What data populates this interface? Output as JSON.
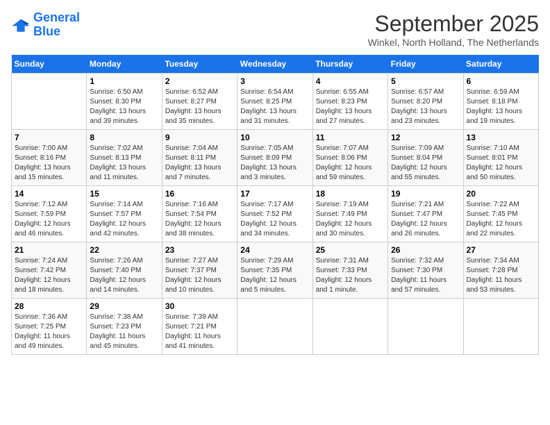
{
  "header": {
    "logo_line1": "General",
    "logo_line2": "Blue",
    "month": "September 2025",
    "location": "Winkel, North Holland, The Netherlands"
  },
  "days_of_week": [
    "Sunday",
    "Monday",
    "Tuesday",
    "Wednesday",
    "Thursday",
    "Friday",
    "Saturday"
  ],
  "weeks": [
    [
      {
        "day": "",
        "info": ""
      },
      {
        "day": "1",
        "info": "Sunrise: 6:50 AM\nSunset: 8:30 PM\nDaylight: 13 hours\nand 39 minutes."
      },
      {
        "day": "2",
        "info": "Sunrise: 6:52 AM\nSunset: 8:27 PM\nDaylight: 13 hours\nand 35 minutes."
      },
      {
        "day": "3",
        "info": "Sunrise: 6:54 AM\nSunset: 8:25 PM\nDaylight: 13 hours\nand 31 minutes."
      },
      {
        "day": "4",
        "info": "Sunrise: 6:55 AM\nSunset: 8:23 PM\nDaylight: 13 hours\nand 27 minutes."
      },
      {
        "day": "5",
        "info": "Sunrise: 6:57 AM\nSunset: 8:20 PM\nDaylight: 13 hours\nand 23 minutes."
      },
      {
        "day": "6",
        "info": "Sunrise: 6:59 AM\nSunset: 8:18 PM\nDaylight: 13 hours\nand 19 minutes."
      }
    ],
    [
      {
        "day": "7",
        "info": "Sunrise: 7:00 AM\nSunset: 8:16 PM\nDaylight: 13 hours\nand 15 minutes."
      },
      {
        "day": "8",
        "info": "Sunrise: 7:02 AM\nSunset: 8:13 PM\nDaylight: 13 hours\nand 11 minutes."
      },
      {
        "day": "9",
        "info": "Sunrise: 7:04 AM\nSunset: 8:11 PM\nDaylight: 13 hours\nand 7 minutes."
      },
      {
        "day": "10",
        "info": "Sunrise: 7:05 AM\nSunset: 8:09 PM\nDaylight: 13 hours\nand 3 minutes."
      },
      {
        "day": "11",
        "info": "Sunrise: 7:07 AM\nSunset: 8:06 PM\nDaylight: 12 hours\nand 59 minutes."
      },
      {
        "day": "12",
        "info": "Sunrise: 7:09 AM\nSunset: 8:04 PM\nDaylight: 12 hours\nand 55 minutes."
      },
      {
        "day": "13",
        "info": "Sunrise: 7:10 AM\nSunset: 8:01 PM\nDaylight: 12 hours\nand 50 minutes."
      }
    ],
    [
      {
        "day": "14",
        "info": "Sunrise: 7:12 AM\nSunset: 7:59 PM\nDaylight: 12 hours\nand 46 minutes."
      },
      {
        "day": "15",
        "info": "Sunrise: 7:14 AM\nSunset: 7:57 PM\nDaylight: 12 hours\nand 42 minutes."
      },
      {
        "day": "16",
        "info": "Sunrise: 7:16 AM\nSunset: 7:54 PM\nDaylight: 12 hours\nand 38 minutes."
      },
      {
        "day": "17",
        "info": "Sunrise: 7:17 AM\nSunset: 7:52 PM\nDaylight: 12 hours\nand 34 minutes."
      },
      {
        "day": "18",
        "info": "Sunrise: 7:19 AM\nSunset: 7:49 PM\nDaylight: 12 hours\nand 30 minutes."
      },
      {
        "day": "19",
        "info": "Sunrise: 7:21 AM\nSunset: 7:47 PM\nDaylight: 12 hours\nand 26 minutes."
      },
      {
        "day": "20",
        "info": "Sunrise: 7:22 AM\nSunset: 7:45 PM\nDaylight: 12 hours\nand 22 minutes."
      }
    ],
    [
      {
        "day": "21",
        "info": "Sunrise: 7:24 AM\nSunset: 7:42 PM\nDaylight: 12 hours\nand 18 minutes."
      },
      {
        "day": "22",
        "info": "Sunrise: 7:26 AM\nSunset: 7:40 PM\nDaylight: 12 hours\nand 14 minutes."
      },
      {
        "day": "23",
        "info": "Sunrise: 7:27 AM\nSunset: 7:37 PM\nDaylight: 12 hours\nand 10 minutes."
      },
      {
        "day": "24",
        "info": "Sunrise: 7:29 AM\nSunset: 7:35 PM\nDaylight: 12 hours\nand 5 minutes."
      },
      {
        "day": "25",
        "info": "Sunrise: 7:31 AM\nSunset: 7:33 PM\nDaylight: 12 hours\nand 1 minute."
      },
      {
        "day": "26",
        "info": "Sunrise: 7:32 AM\nSunset: 7:30 PM\nDaylight: 11 hours\nand 57 minutes."
      },
      {
        "day": "27",
        "info": "Sunrise: 7:34 AM\nSunset: 7:28 PM\nDaylight: 11 hours\nand 53 minutes."
      }
    ],
    [
      {
        "day": "28",
        "info": "Sunrise: 7:36 AM\nSunset: 7:25 PM\nDaylight: 11 hours\nand 49 minutes."
      },
      {
        "day": "29",
        "info": "Sunrise: 7:38 AM\nSunset: 7:23 PM\nDaylight: 11 hours\nand 45 minutes."
      },
      {
        "day": "30",
        "info": "Sunrise: 7:39 AM\nSunset: 7:21 PM\nDaylight: 11 hours\nand 41 minutes."
      },
      {
        "day": "",
        "info": ""
      },
      {
        "day": "",
        "info": ""
      },
      {
        "day": "",
        "info": ""
      },
      {
        "day": "",
        "info": ""
      }
    ]
  ]
}
